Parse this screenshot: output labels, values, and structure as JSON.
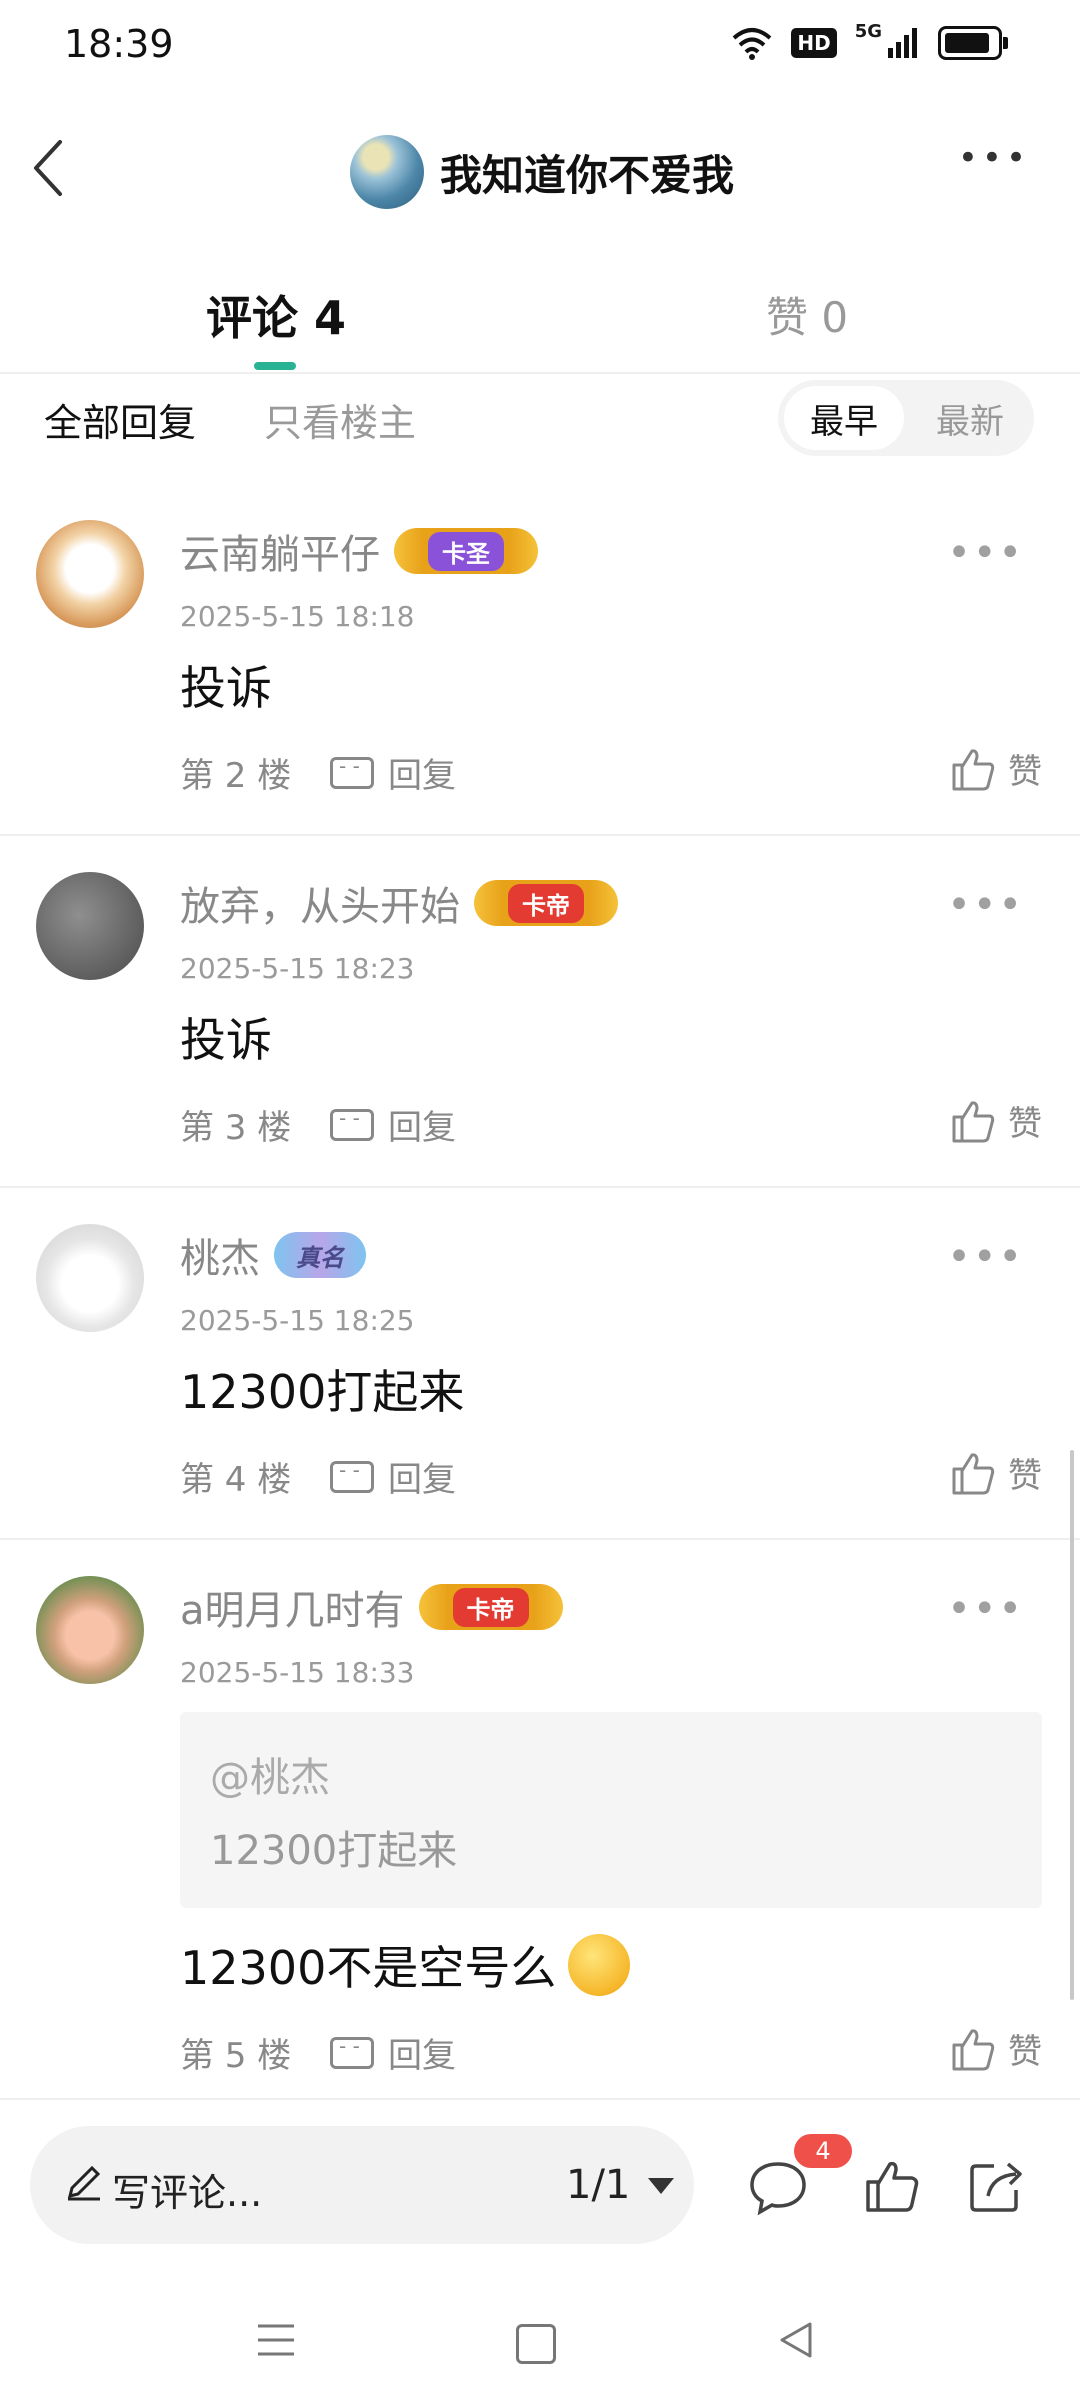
{
  "status_bar": {
    "time": "18:39",
    "hd": "HD",
    "network": "5G"
  },
  "header": {
    "title": "我知道你不爱我",
    "more": "•••"
  },
  "tabs": [
    {
      "label": "评论 4"
    },
    {
      "label": "赞 0"
    }
  ],
  "filters": {
    "all": "全部回复",
    "owner_only": "只看楼主"
  },
  "sort": {
    "earliest": "最早",
    "latest": "最新"
  },
  "comments": [
    {
      "user": "云南躺平仔",
      "badge": "卡圣",
      "time": "2025-5-15 18:18",
      "content": "投诉",
      "floor": "第 2 楼",
      "reply": "回复",
      "like": "赞"
    },
    {
      "user": "放弃，从头开始",
      "badge": "卡帝",
      "time": "2025-5-15 18:23",
      "content": "投诉",
      "floor": "第 3 楼",
      "reply": "回复",
      "like": "赞"
    },
    {
      "user": "桃杰",
      "badge": "真名",
      "time": "2025-5-15 18:25",
      "content": "12300打起来",
      "floor": "第 4 楼",
      "reply": "回复",
      "like": "赞"
    },
    {
      "user": "a明月几时有",
      "badge": "卡帝",
      "time": "2025-5-15 18:33",
      "quote_mention": "@桃杰",
      "quote_text": "12300打起来",
      "content": "12300不是空号么",
      "floor": "第 5 楼",
      "reply": "回复",
      "like": "赞"
    }
  ],
  "bottom_bar": {
    "compose": "写评论...",
    "page": "1/1",
    "comment_count": "4"
  }
}
